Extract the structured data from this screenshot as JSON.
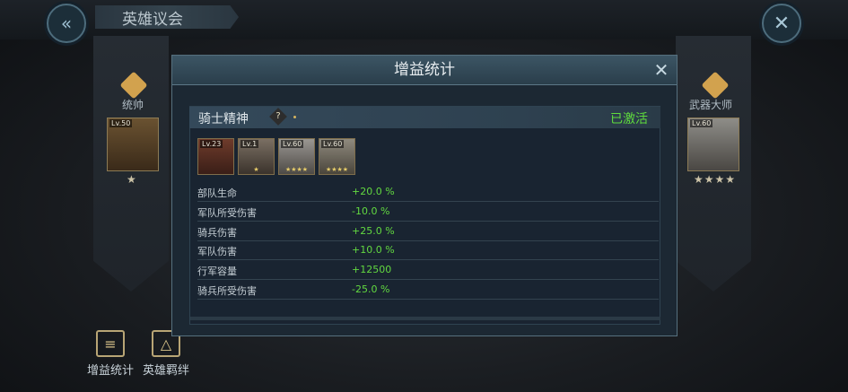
{
  "header": {
    "title": "英雄议会"
  },
  "left_panel": {
    "label": "统帅",
    "portrait_level": "Lv.50",
    "stars": "★"
  },
  "right_panel": {
    "label": "武器大师",
    "portrait_level": "Lv.60",
    "stars": "★★★★"
  },
  "bottom_buttons": [
    {
      "label": "增益统计"
    },
    {
      "label": "英雄羁绊"
    }
  ],
  "modal": {
    "title": "增益统计",
    "bond": {
      "name": "骑士精神",
      "help": "?",
      "status": "已激活"
    },
    "heroes": [
      {
        "level": "Lv.23",
        "stars": ""
      },
      {
        "level": "Lv.1",
        "stars": "★"
      },
      {
        "level": "Lv.60",
        "stars": "★★★★"
      },
      {
        "level": "Lv.60",
        "stars": "★★★★"
      }
    ],
    "stats": [
      {
        "name": "部队生命",
        "value": "+20.0 %"
      },
      {
        "name": "军队所受伤害",
        "value": "-10.0 %"
      },
      {
        "name": "骑兵伤害",
        "value": "+25.0 %"
      },
      {
        "name": "军队伤害",
        "value": "+10.0 %"
      },
      {
        "name": "行军容量",
        "value": "+12500"
      },
      {
        "name": "骑兵所受伤害",
        "value": "-25.0 %"
      }
    ]
  },
  "colors": {
    "accent_green": "#5fdc3d",
    "panel_bg": "#1c2833",
    "header_bg": "#3c5564"
  }
}
